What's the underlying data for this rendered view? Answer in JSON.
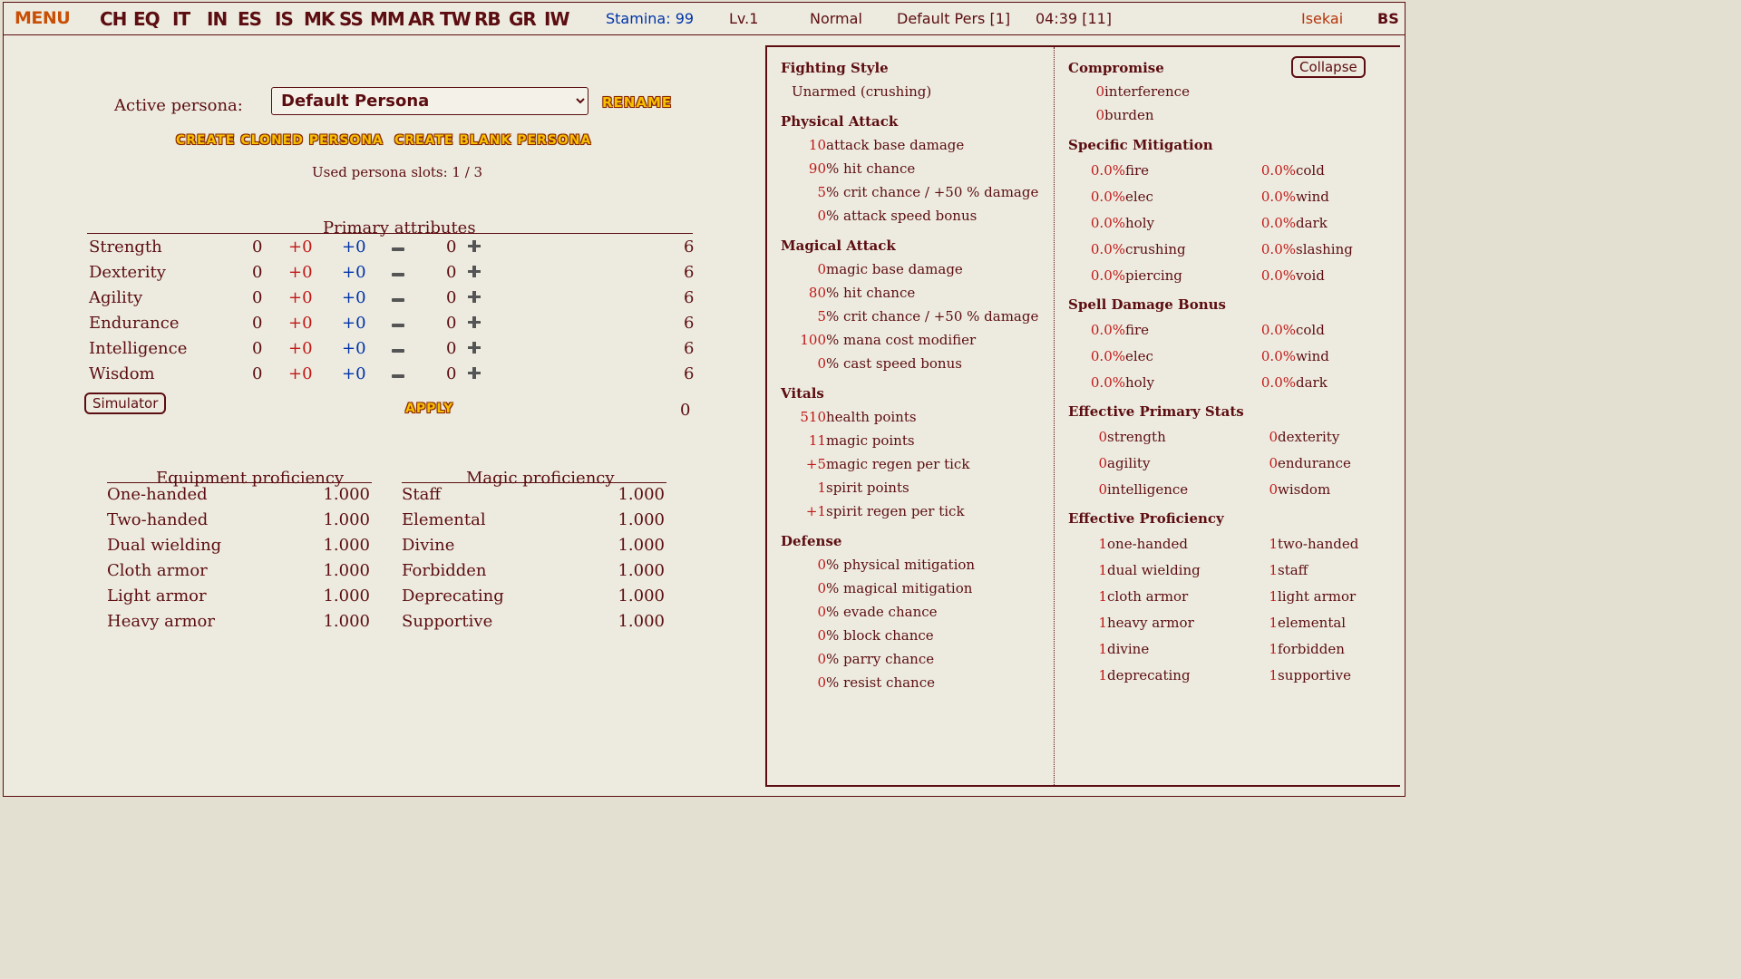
{
  "topbar": {
    "menu": "MENU",
    "nav": [
      "CH",
      "EQ",
      "IT",
      "IN",
      "ES",
      "IS",
      "MK",
      "SS",
      "MM",
      "AR",
      "TW",
      "RB",
      "GR",
      "IW"
    ],
    "stamina": "Stamina: 99",
    "level": "Lv.1",
    "difficulty": "Normal",
    "persona": "Default Pers [1]",
    "time": "04:39 [11]",
    "isekai": "Isekai",
    "bs": "BS"
  },
  "persona": {
    "label": "Active persona:",
    "selected": "Default Persona",
    "rename": "Rename",
    "create_cloned": "Create cloned persona",
    "create_blank": "Create blank persona",
    "slots": "Used persona slots: 1 / 3"
  },
  "attributes": {
    "title": "Primary attributes",
    "rows": [
      {
        "name": "Strength",
        "base": "0",
        "red": "+0",
        "blue": "+0",
        "assign": "0",
        "total": "6"
      },
      {
        "name": "Dexterity",
        "base": "0",
        "red": "+0",
        "blue": "+0",
        "assign": "0",
        "total": "6"
      },
      {
        "name": "Agility",
        "base": "0",
        "red": "+0",
        "blue": "+0",
        "assign": "0",
        "total": "6"
      },
      {
        "name": "Endurance",
        "base": "0",
        "red": "+0",
        "blue": "+0",
        "assign": "0",
        "total": "6"
      },
      {
        "name": "Intelligence",
        "base": "0",
        "red": "+0",
        "blue": "+0",
        "assign": "0",
        "total": "6"
      },
      {
        "name": "Wisdom",
        "base": "0",
        "red": "+0",
        "blue": "+0",
        "assign": "0",
        "total": "6"
      }
    ],
    "simulator": "Simulator",
    "apply": "Apply",
    "remaining": "0"
  },
  "equipment": {
    "title": "Equipment proficiency",
    "rows": [
      {
        "name": "One-handed",
        "value": "1.000"
      },
      {
        "name": "Two-handed",
        "value": "1.000"
      },
      {
        "name": "Dual wielding",
        "value": "1.000"
      },
      {
        "name": "Cloth armor",
        "value": "1.000"
      },
      {
        "name": "Light armor",
        "value": "1.000"
      },
      {
        "name": "Heavy armor",
        "value": "1.000"
      }
    ]
  },
  "magic": {
    "title": "Magic proficiency",
    "rows": [
      {
        "name": "Staff",
        "value": "1.000"
      },
      {
        "name": "Elemental",
        "value": "1.000"
      },
      {
        "name": "Divine",
        "value": "1.000"
      },
      {
        "name": "Forbidden",
        "value": "1.000"
      },
      {
        "name": "Deprecating",
        "value": "1.000"
      },
      {
        "name": "Supportive",
        "value": "1.000"
      }
    ]
  },
  "stats_left": {
    "fighting_style": {
      "title": "Fighting Style",
      "value": "Unarmed (crushing)"
    },
    "physical_attack": {
      "title": "Physical Attack",
      "rows": [
        {
          "v": "10",
          "n": " attack base damage"
        },
        {
          "v": "90",
          "n": " % hit chance"
        },
        {
          "v": "5",
          "n": " % crit chance / +50 % damage"
        },
        {
          "v": "0",
          "n": " % attack speed bonus"
        }
      ]
    },
    "magical_attack": {
      "title": "Magical Attack",
      "rows": [
        {
          "v": "0",
          "n": " magic base damage"
        },
        {
          "v": "80",
          "n": " % hit chance"
        },
        {
          "v": "5",
          "n": " % crit chance / +50 % damage"
        },
        {
          "v": "100",
          "n": " % mana cost modifier"
        },
        {
          "v": "0",
          "n": " % cast speed bonus"
        }
      ]
    },
    "vitals": {
      "title": "Vitals",
      "rows": [
        {
          "v": "510",
          "n": " health points"
        },
        {
          "v": "11",
          "n": " magic points"
        },
        {
          "v": "+5",
          "n": " magic regen per tick"
        },
        {
          "v": "1",
          "n": " spirit points"
        },
        {
          "v": "+1",
          "n": " spirit regen per tick"
        }
      ]
    },
    "defense": {
      "title": "Defense",
      "rows": [
        {
          "v": "0",
          "n": " % physical mitigation"
        },
        {
          "v": "0",
          "n": " % magical mitigation"
        },
        {
          "v": "0",
          "n": " % evade chance"
        },
        {
          "v": "0",
          "n": " % block chance"
        },
        {
          "v": "0",
          "n": " % parry chance"
        },
        {
          "v": "0",
          "n": " % resist chance"
        }
      ]
    }
  },
  "stats_right": {
    "collapse": "Collapse",
    "compromise": {
      "title": "Compromise",
      "rows": [
        {
          "v": "0",
          "n": " interference"
        },
        {
          "v": "0",
          "n": " burden"
        }
      ]
    },
    "specific_mitigation": {
      "title": "Specific Mitigation",
      "rows": [
        [
          {
            "v": "0.0%",
            "n": " fire"
          },
          {
            "v": "0.0%",
            "n": " cold"
          }
        ],
        [
          {
            "v": "0.0%",
            "n": " elec"
          },
          {
            "v": "0.0%",
            "n": " wind"
          }
        ],
        [
          {
            "v": "0.0%",
            "n": " holy"
          },
          {
            "v": "0.0%",
            "n": " dark"
          }
        ],
        [
          {
            "v": "0.0%",
            "n": " crushing"
          },
          {
            "v": "0.0%",
            "n": " slashing"
          }
        ],
        [
          {
            "v": "0.0%",
            "n": " piercing"
          },
          {
            "v": "0.0%",
            "n": " void"
          }
        ]
      ]
    },
    "spell_damage": {
      "title": "Spell Damage Bonus",
      "rows": [
        [
          {
            "v": "0.0%",
            "n": " fire"
          },
          {
            "v": "0.0%",
            "n": " cold"
          }
        ],
        [
          {
            "v": "0.0%",
            "n": " elec"
          },
          {
            "v": "0.0%",
            "n": " wind"
          }
        ],
        [
          {
            "v": "0.0%",
            "n": " holy"
          },
          {
            "v": "0.0%",
            "n": " dark"
          }
        ]
      ]
    },
    "effective_primary": {
      "title": "Effective Primary Stats",
      "rows": [
        [
          {
            "v": "0",
            "n": " strength"
          },
          {
            "v": "0",
            "n": " dexterity"
          }
        ],
        [
          {
            "v": "0",
            "n": " agility"
          },
          {
            "v": "0",
            "n": " endurance"
          }
        ],
        [
          {
            "v": "0",
            "n": " intelligence"
          },
          {
            "v": "0",
            "n": " wisdom"
          }
        ]
      ]
    },
    "effective_proficiency": {
      "title": "Effective Proficiency",
      "rows": [
        [
          {
            "v": "1",
            "n": " one-handed"
          },
          {
            "v": "1",
            "n": " two-handed"
          }
        ],
        [
          {
            "v": "1",
            "n": " dual wielding"
          },
          {
            "v": "1",
            "n": " staff"
          }
        ],
        [
          {
            "v": "1",
            "n": " cloth armor"
          },
          {
            "v": "1",
            "n": " light armor"
          }
        ],
        [
          {
            "v": "1",
            "n": " heavy armor"
          },
          {
            "v": "1",
            "n": " elemental"
          }
        ],
        [
          {
            "v": "1",
            "n": " divine"
          },
          {
            "v": "1",
            "n": " forbidden"
          }
        ],
        [
          {
            "v": "1",
            "n": " deprecating"
          },
          {
            "v": "1",
            "n": " supportive"
          }
        ]
      ]
    }
  }
}
